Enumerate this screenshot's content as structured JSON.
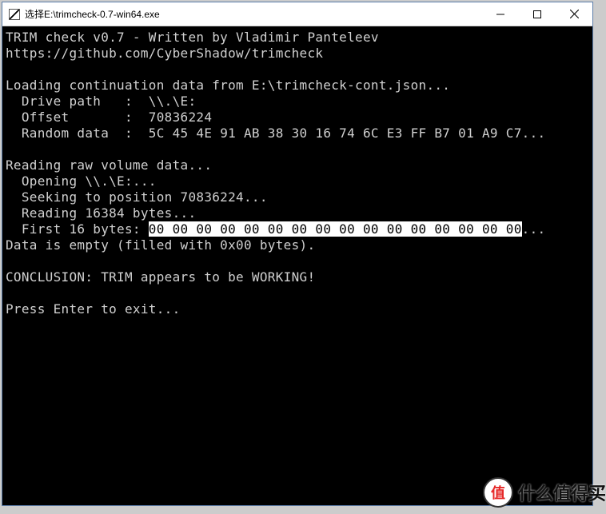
{
  "window": {
    "title": "选择E:\\trimcheck-0.7-win64.exe"
  },
  "console": {
    "header_app": "TRIM check v0.7 - Written by Vladimir Panteleev",
    "header_url": "https://github.com/CyberShadow/trimcheck",
    "loading_line": "Loading continuation data from E:\\trimcheck-cont.json...",
    "drive_label": "  Drive path   :  ",
    "drive_value": "\\\\.\\E:",
    "offset_label": "  Offset       :  ",
    "offset_value": "70836224",
    "random_label": "  Random data  :  ",
    "random_value": "5C 45 4E 91 AB 38 30 16 74 6C E3 FF B7 01 A9 C7...",
    "reading_header": "Reading raw volume data...",
    "opening_line": "  Opening \\\\.\\E:...",
    "seeking_line": "  Seeking to position 70836224...",
    "reading_line": "  Reading 16384 bytes...",
    "first16_label": "  First 16 bytes: ",
    "first16_value": "00 00 00 00 00 00 00 00 00 00 00 00 00 00 00 00",
    "first16_tail": "...",
    "empty_line": "Data is empty (filled with 0x00 bytes).",
    "conclusion": "CONCLUSION: TRIM appears to be WORKING!",
    "exit_prompt": "Press Enter to exit..."
  },
  "watermark": {
    "badge": "值",
    "text": "什么值得买"
  }
}
